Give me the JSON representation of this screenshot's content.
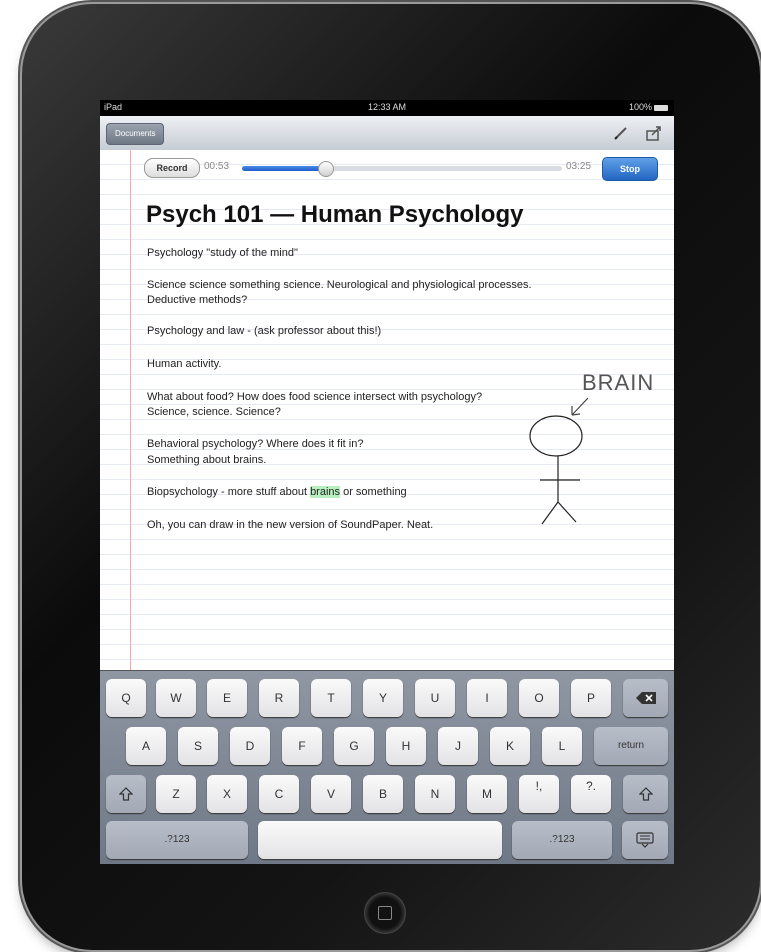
{
  "status_bar": {
    "device": "iPad",
    "time": "12:33 AM",
    "battery": "100%"
  },
  "toolbar": {
    "documents_label": "Documents",
    "pen_icon": "pen-icon",
    "share_icon": "share-icon"
  },
  "recorder": {
    "record_label": "Record",
    "elapsed": "00:53",
    "total": "03:25",
    "progress": 0.26,
    "stop_label": "Stop"
  },
  "note": {
    "title": "Psych 101 — Human Psychology",
    "paragraphs": [
      {
        "lines": [
          "Psychology \"study of the mind\""
        ]
      },
      {
        "lines": [
          "Science science something science. Neurological and physiological processes.",
          "Deductive methods?"
        ]
      },
      {
        "lines": [
          "Psychology and law - (ask professor about this!)"
        ]
      },
      {
        "lines": [
          "Human activity."
        ]
      },
      {
        "lines": [
          "What about food? How does food science intersect with psychology?",
          "Science, science. Science?"
        ]
      },
      {
        "lines": [
          "Behavioral psychology? Where does it fit in?",
          "Something about brains."
        ]
      },
      {
        "before": "Biopsychology - more stuff about ",
        "highlight": "brains",
        "after": " or something"
      },
      {
        "lines": [
          "Oh, you can draw in the new version of SoundPaper. Neat."
        ]
      }
    ],
    "drawing_label": "BRAIN"
  },
  "keyboard": {
    "row1": [
      "Q",
      "W",
      "E",
      "R",
      "T",
      "Y",
      "U",
      "I",
      "O",
      "P"
    ],
    "row2": [
      "A",
      "S",
      "D",
      "F",
      "G",
      "H",
      "J",
      "K",
      "L"
    ],
    "row3": [
      "Z",
      "X",
      "C",
      "V",
      "B",
      "N",
      "M"
    ],
    "return_label": "return",
    "numbers_label": ".?123",
    "punct1": "!,",
    "punct2": "?."
  },
  "colors": {
    "accent": "#2366c2",
    "highlight": "#b8f0c0",
    "margin": "#f3a9a9"
  }
}
